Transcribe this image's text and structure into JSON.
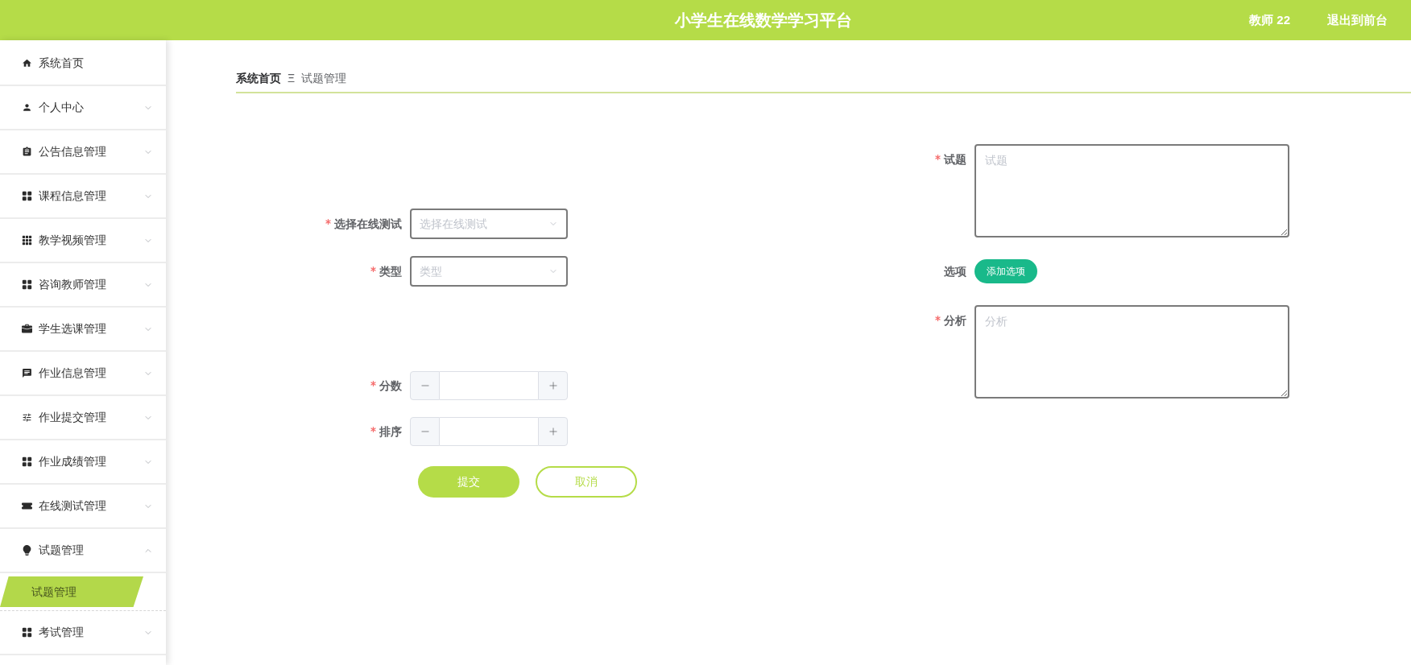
{
  "header": {
    "title": "小学生在线数学学习平台",
    "user": "教师 22",
    "exit_link": "退出到前台"
  },
  "sidebar": {
    "items": [
      {
        "label": "系统首页",
        "kind": "link"
      },
      {
        "label": "个人中心",
        "kind": "menu",
        "expanded": false
      },
      {
        "label": "公告信息管理",
        "kind": "menu",
        "expanded": false
      },
      {
        "label": "课程信息管理",
        "kind": "menu",
        "expanded": false
      },
      {
        "label": "教学视频管理",
        "kind": "menu",
        "expanded": false
      },
      {
        "label": "咨询教师管理",
        "kind": "menu",
        "expanded": false
      },
      {
        "label": "学生选课管理",
        "kind": "menu",
        "expanded": false
      },
      {
        "label": "作业信息管理",
        "kind": "menu",
        "expanded": false
      },
      {
        "label": "作业提交管理",
        "kind": "menu",
        "expanded": false
      },
      {
        "label": "作业成绩管理",
        "kind": "menu",
        "expanded": false
      },
      {
        "label": "在线测试管理",
        "kind": "menu",
        "expanded": false
      },
      {
        "label": "试题管理",
        "kind": "menu",
        "expanded": true,
        "children": [
          {
            "label": "试题管理",
            "selected": true
          }
        ]
      },
      {
        "label": "考试管理",
        "kind": "menu",
        "expanded": false
      }
    ]
  },
  "breadcrumb": {
    "home": "系统首页",
    "separator": "Ξ",
    "current": "试题管理"
  },
  "form": {
    "left_fields": [
      {
        "kind": "select",
        "label": "选择在线测试",
        "required": true,
        "placeholder": "选择在线测试"
      },
      {
        "kind": "select",
        "label": "类型",
        "required": true,
        "placeholder": "类型"
      },
      {
        "kind": "number",
        "label": "分数",
        "required": true
      },
      {
        "kind": "number",
        "label": "排序",
        "required": true
      }
    ],
    "right_fields": [
      {
        "kind": "textarea",
        "label": "试题",
        "required": true,
        "placeholder": "试题"
      },
      {
        "kind": "button",
        "label": "选项",
        "required": false,
        "button": "添加选项"
      },
      {
        "kind": "textarea",
        "label": "分析",
        "required": true,
        "placeholder": "分析"
      }
    ],
    "buttons": [
      {
        "label": "提交",
        "kind": "primary"
      },
      {
        "label": "取消",
        "kind": "outline"
      }
    ]
  }
}
